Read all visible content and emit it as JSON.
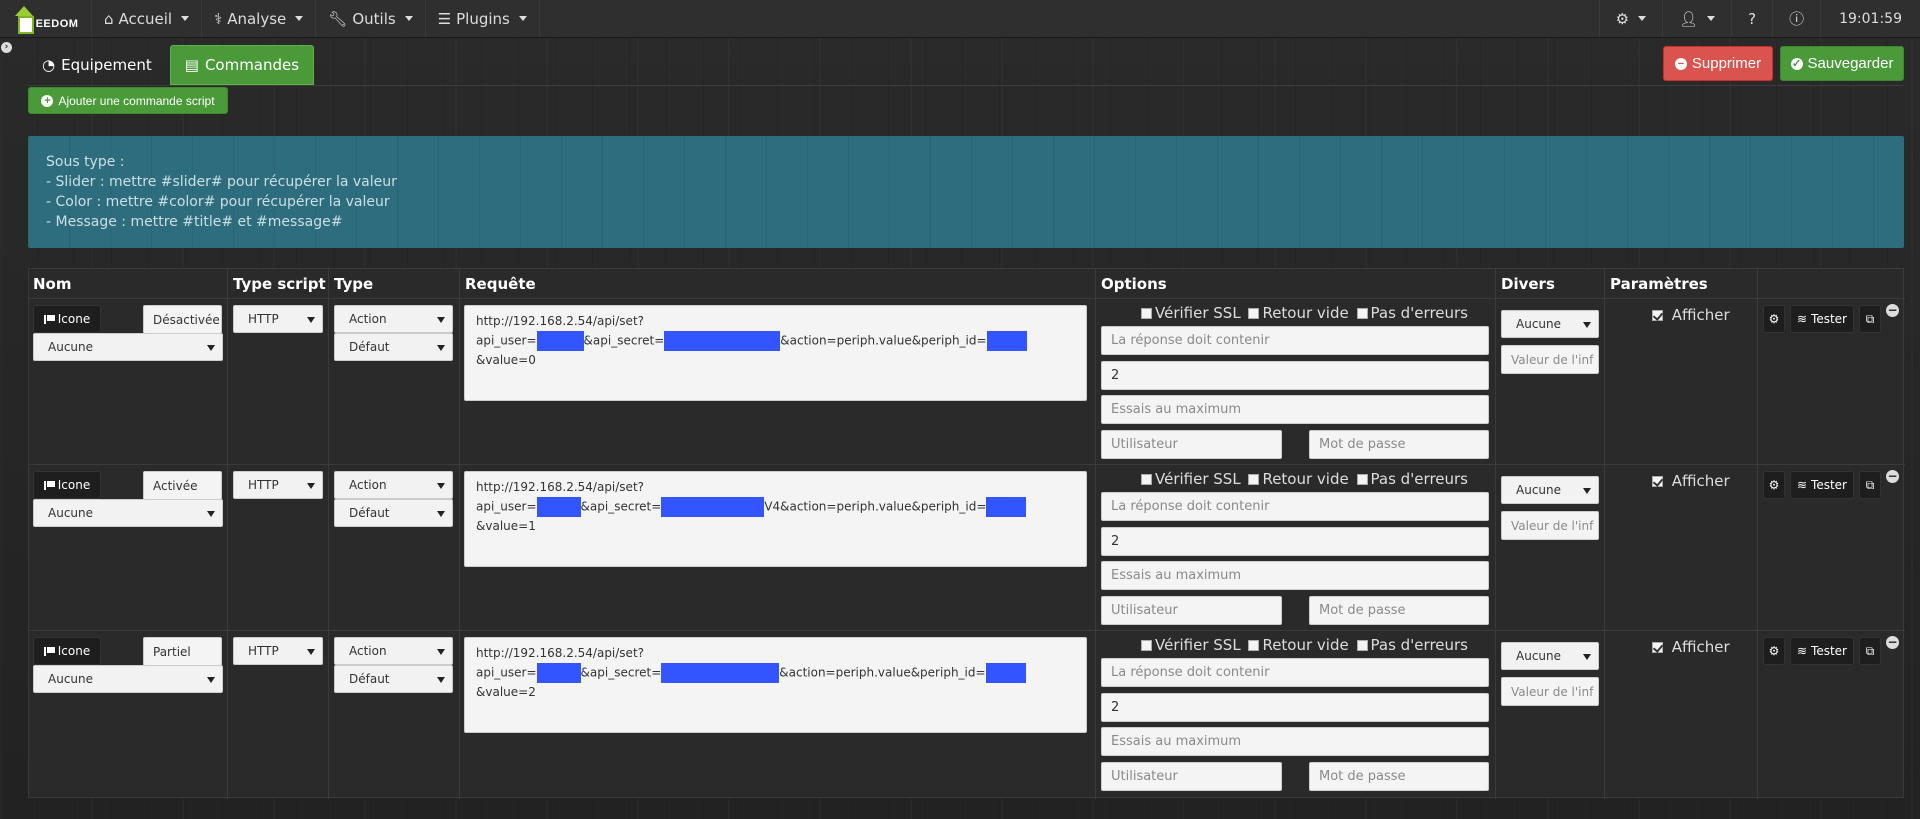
{
  "navbar": {
    "logo_text": "EEDOM",
    "menus": [
      {
        "label": "Accueil",
        "icon": "home-icon"
      },
      {
        "label": "Analyse",
        "icon": "stethoscope-icon"
      },
      {
        "label": "Outils",
        "icon": "wrench-icon"
      },
      {
        "label": "Plugins",
        "icon": "list-icon"
      }
    ],
    "clock": "19:01:59"
  },
  "tabs": {
    "equipement": "Equipement",
    "commandes": "Commandes"
  },
  "actions": {
    "delete": "Supprimer",
    "save": "Sauvegarder",
    "add_command": "Ajouter une commande script"
  },
  "info": {
    "line1": "Sous type :",
    "line2": "- Slider : mettre #slider# pour récupérer la valeur",
    "line3": "- Color : mettre #color# pour récupérer la valeur",
    "line4": "- Message : mettre #title# et #message#"
  },
  "table": {
    "headers": {
      "nom": "Nom",
      "type_script": "Type script",
      "type": "Type",
      "requete": "Requête",
      "options": "Options",
      "divers": "Divers",
      "parametres": "Paramètres"
    },
    "labels": {
      "icon_button": "Icone",
      "verify_ssl": "Vérifier SSL",
      "empty_return": "Retour vide",
      "no_errors": "Pas d'erreurs",
      "response_placeholder": "La réponse doit contenir",
      "tries_placeholder": "Essais au maximum",
      "user_placeholder": "Utilisateur",
      "password_placeholder": "Mot de passe",
      "info_placeholder": "Valeur de l'inf",
      "afficher": "Afficher",
      "tester": "Tester"
    },
    "rows": [
      {
        "name": "Désactivée",
        "object": "Aucune",
        "script_type": "HTTP",
        "type": "Action",
        "subtype": "Défaut",
        "request_line1": "http://192.168.2.54/api/set?",
        "request_user_prefix": "api_user=",
        "request_secret_prefix": "&api_secret=",
        "request_secret_suffix": "",
        "request_action": "&action=periph.value&periph_id=",
        "request_value": "&value=0",
        "timeout": "2",
        "divers": "Aucune",
        "afficher_checked": true
      },
      {
        "name": "Activée",
        "object": "Aucune",
        "script_type": "HTTP",
        "type": "Action",
        "subtype": "Défaut",
        "request_line1": "http://192.168.2.54/api/set?",
        "request_user_prefix": "api_user=",
        "request_secret_prefix": "&api_secret=",
        "request_secret_suffix": "V4",
        "request_action": "&action=periph.value&periph_id=",
        "request_value": "&value=1",
        "timeout": "2",
        "divers": "Aucune",
        "afficher_checked": true
      },
      {
        "name": "Partiel",
        "object": "Aucune",
        "script_type": "HTTP",
        "type": "Action",
        "subtype": "Défaut",
        "request_line1": "http://192.168.2.54/api/set?",
        "request_user_prefix": "api_user=",
        "request_secret_prefix": "&api_secret=",
        "request_secret_suffix": "",
        "request_action": "&action=periph.value&periph_id=",
        "request_value": "&value=2",
        "timeout": "2",
        "divers": "Aucune",
        "afficher_checked": true
      }
    ]
  },
  "colors": {
    "accent_green": "#4a9a3a",
    "danger_red": "#d9534f",
    "info_teal": "#2e7385",
    "redaction_blue": "#3355ff"
  }
}
